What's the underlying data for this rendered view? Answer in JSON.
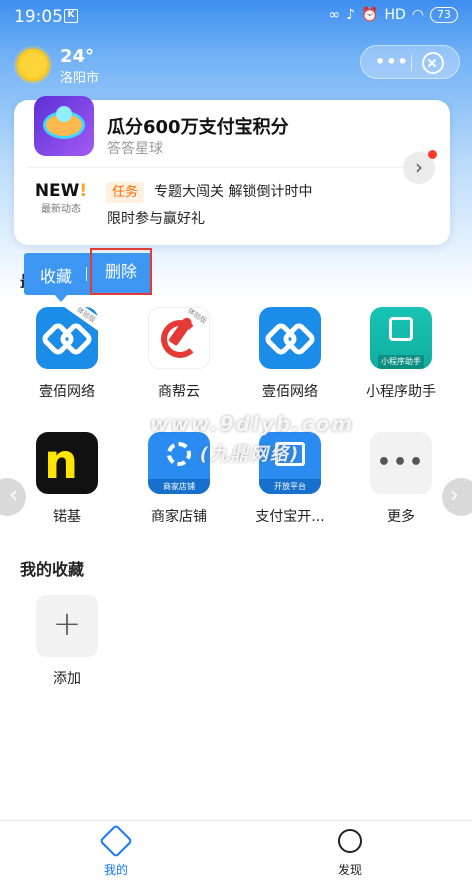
{
  "status_bar": {
    "time": "19:05",
    "app_badge": "K",
    "network": "HD",
    "battery": "73"
  },
  "header": {
    "temperature": "24°",
    "city": "洛阳市"
  },
  "promo_card": {
    "title": "瓜分600万支付宝积分",
    "subtitle": "答答星球",
    "news_badge_main": "NEW",
    "news_badge_bang": "!",
    "news_badge_sub": "最新动态",
    "task_tag": "任务",
    "task_line1": "专题大闯关 解锁倒计时中",
    "task_line2": "限时参与赢好礼"
  },
  "section_hidden": {
    "label": "最"
  },
  "popup_menu": {
    "favorite_label": "收藏",
    "delete_label": "删除"
  },
  "apps": [
    {
      "label": "壹佰网络",
      "icon": "yibai-icon",
      "badge": "体验版"
    },
    {
      "label": "商帮云",
      "icon": "shangbang-icon",
      "badge": "体验版"
    },
    {
      "label": "壹佰网络",
      "icon": "yibai-icon",
      "badge": ""
    },
    {
      "label": "小程序助手",
      "icon": "mini-program-icon",
      "badge": "小程序助手"
    },
    {
      "label": "锘基",
      "icon": "nuoji-icon",
      "badge": ""
    },
    {
      "label": "商家店铺",
      "icon": "store-icon",
      "badge": "商家店铺"
    },
    {
      "label": "支付宝开...",
      "icon": "open-platform-icon",
      "badge": "开放平台"
    },
    {
      "label": "更多",
      "icon": "more-icon",
      "badge": ""
    }
  ],
  "favorites": {
    "title": "我的收藏",
    "add_label": "添加",
    "add_symbol": "+"
  },
  "watermark": {
    "line1": "www.9dlyb.com",
    "line2": "(九鼎网络)"
  },
  "tabbar": {
    "mine": "我的",
    "discover": "发现"
  },
  "colors": {
    "accent": "#1677ff",
    "popup": "#3c96f2",
    "highlight": "#e53935"
  }
}
